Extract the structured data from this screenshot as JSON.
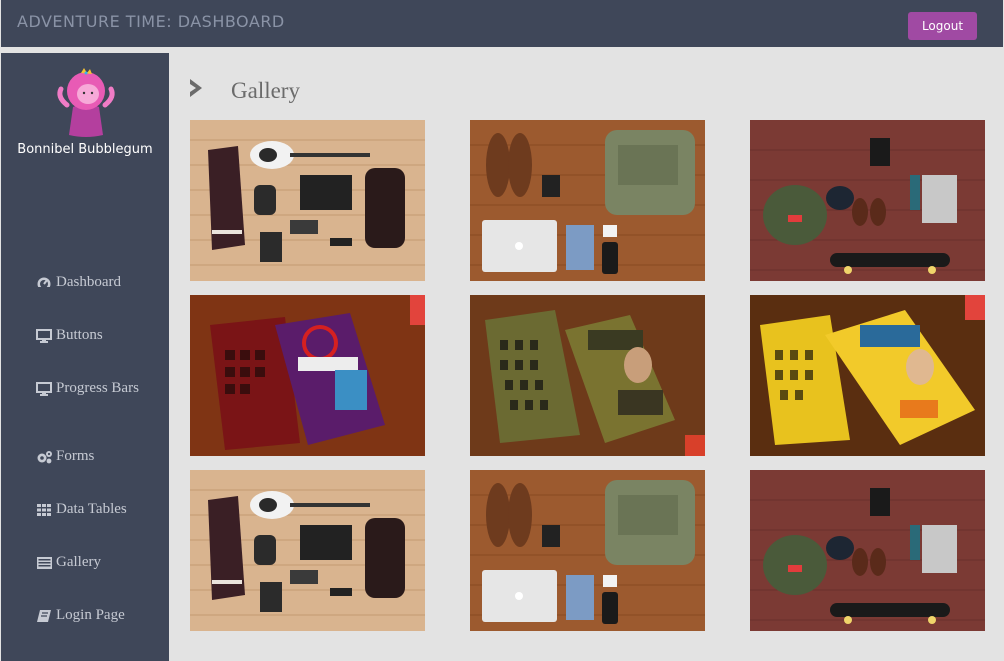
{
  "header": {
    "app_title": "ADVENTURE TIME: DASHBOARD",
    "logout_label": "Logout"
  },
  "sidebar": {
    "user_name": "Bonnibel Bubblegum",
    "items": [
      {
        "label": "Dashboard",
        "icon": "dashboard-icon"
      },
      {
        "label": "Buttons",
        "icon": "monitor-icon"
      },
      {
        "label": "Progress Bars",
        "icon": "monitor-icon"
      },
      {
        "label": "Forms",
        "icon": "cogs-icon"
      },
      {
        "label": "Data Tables",
        "icon": "grid-icon"
      },
      {
        "label": "Gallery",
        "icon": "gallery-icon"
      },
      {
        "label": "Login Page",
        "icon": "book-icon"
      }
    ]
  },
  "page": {
    "title": "Gallery",
    "header_icon": "chevron-right-icon"
  },
  "gallery": {
    "images": [
      {
        "subject": "flatlay-guitar-jacket"
      },
      {
        "subject": "flatlay-shoes-backpack-laptop"
      },
      {
        "subject": "flatlay-skateboard-backpack"
      },
      {
        "subject": "books-eat-free"
      },
      {
        "subject": "books-out-front"
      },
      {
        "subject": "books-marketing-mindsets"
      },
      {
        "subject": "flatlay-guitar-jacket"
      },
      {
        "subject": "flatlay-shoes-backpack-laptop"
      },
      {
        "subject": "flatlay-skateboard-backpack"
      }
    ]
  },
  "colors": {
    "topbar": "#3f4759",
    "sidebar": "#3f4759",
    "background": "#e3e3e3",
    "logout_button": "#a04aa3",
    "nav_text": "#c6cad3",
    "title_text": "#6b6b6b"
  }
}
